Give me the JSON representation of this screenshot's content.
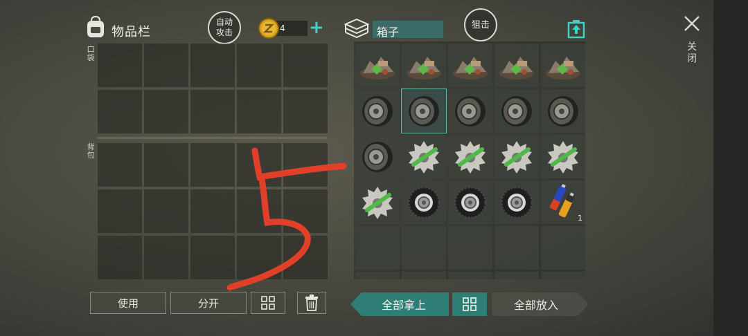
{
  "header": {
    "inventory_title": "物品栏",
    "auto_attack": "自动攻击",
    "coin_count": "4",
    "box_title": "箱子",
    "snipe": "狙击",
    "close_label": "关闭"
  },
  "inventory": {
    "pocket_label": "口袋",
    "backpack_label": "背包",
    "pocket_slots": 10,
    "backpack_slots": 15
  },
  "box": {
    "rows": [
      [
        {
          "item": "scrap-pile-icon"
        },
        {
          "item": "scrap-pile-icon"
        },
        {
          "item": "scrap-pile-icon"
        },
        {
          "item": "scrap-pile-icon"
        },
        {
          "item": "scrap-pile-icon"
        }
      ],
      [
        {
          "item": "wheel-disc-icon"
        },
        {
          "item": "wheel-disc-icon",
          "selected": true
        },
        {
          "item": "wheel-disc-icon"
        },
        {
          "item": "wheel-disc-icon"
        },
        {
          "item": "wheel-disc-icon"
        }
      ],
      [
        {
          "item": "wheel-disc-icon"
        },
        {
          "item": "saw-blade-icon"
        },
        {
          "item": "saw-blade-icon"
        },
        {
          "item": "saw-blade-icon"
        },
        {
          "item": "saw-blade-icon"
        }
      ],
      [
        {
          "item": "saw-blade-icon"
        },
        {
          "item": "tire-icon"
        },
        {
          "item": "tire-icon"
        },
        {
          "item": "tire-icon"
        },
        {
          "item": "battery-icon",
          "qty": "1"
        }
      ],
      [
        {},
        {},
        {},
        {},
        {}
      ],
      [
        {},
        {},
        {},
        {},
        {}
      ]
    ]
  },
  "actions": {
    "use": "使用",
    "split": "分开",
    "take_all": "全部拿上",
    "put_all": "全部放入"
  },
  "colors": {
    "accent": "#2e7e75",
    "accent_bright": "#3fd2c3",
    "scribble": "#e0402a"
  }
}
